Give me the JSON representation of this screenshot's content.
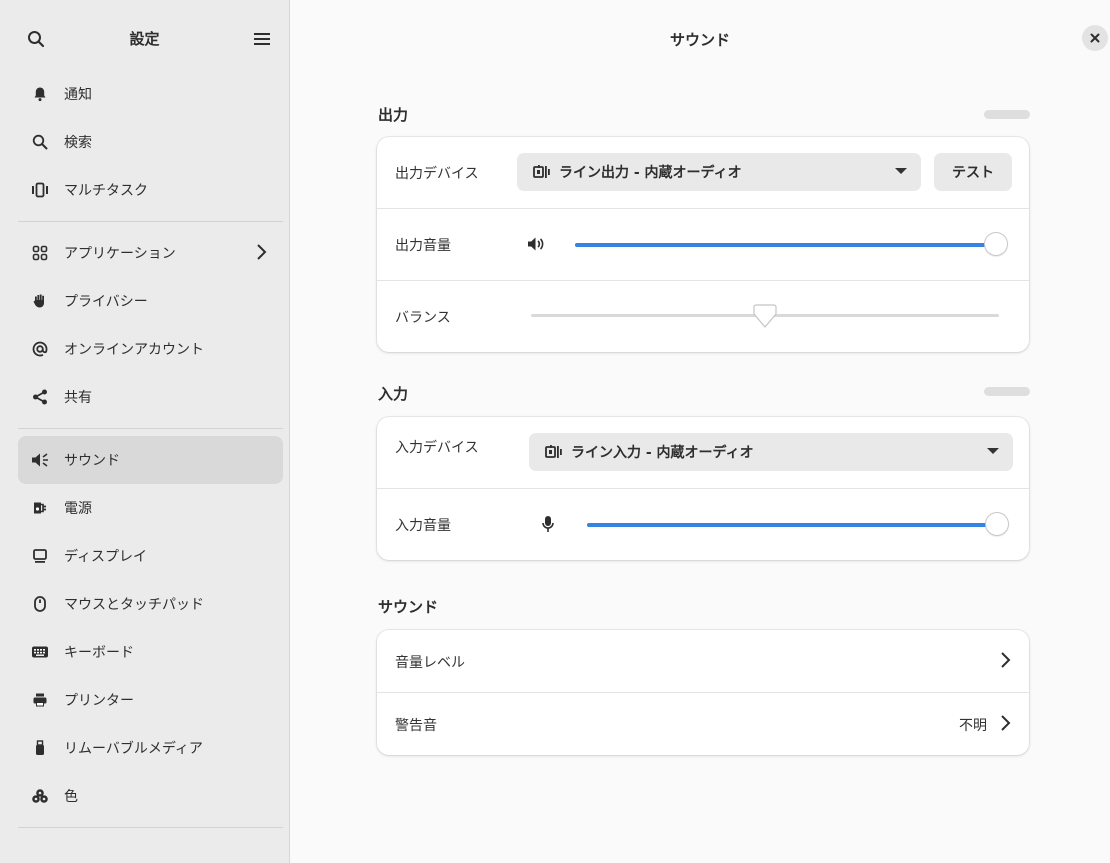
{
  "sidebar": {
    "title": "設定",
    "items": [
      {
        "label": "通知",
        "icon": "bell-icon"
      },
      {
        "label": "検索",
        "icon": "search-icon"
      },
      {
        "label": "マルチタスク",
        "icon": "multitask-icon"
      },
      {
        "label": "アプリケーション",
        "icon": "apps-grid-icon"
      },
      {
        "label": "プライバシー",
        "icon": "hand-icon"
      },
      {
        "label": "オンラインアカウント",
        "icon": "at-sign-icon"
      },
      {
        "label": "共有",
        "icon": "share-icon"
      },
      {
        "label": "サウンド",
        "icon": "speaker-icon"
      },
      {
        "label": "電源",
        "icon": "power-icon"
      },
      {
        "label": "ディスプレイ",
        "icon": "display-icon"
      },
      {
        "label": "マウスとタッチパッド",
        "icon": "mouse-icon"
      },
      {
        "label": "キーボード",
        "icon": "keyboard-icon"
      },
      {
        "label": "プリンター",
        "icon": "printer-icon"
      },
      {
        "label": "リムーバブルメディア",
        "icon": "usb-icon"
      },
      {
        "label": "色",
        "icon": "color-icon"
      }
    ]
  },
  "main": {
    "title": "サウンド",
    "output": {
      "section": "出力",
      "device_label": "出力デバイス",
      "device_value": "ライン出力 - 内蔵オーディオ",
      "test_label": "テスト",
      "volume_label": "出力音量",
      "volume_level": 1.0,
      "balance_label": "バランス",
      "balance_level": 0.5
    },
    "input": {
      "section": "入力",
      "device_label": "入力デバイス",
      "device_value": "ライン入力 - 内蔵オーディオ",
      "volume_label": "入力音量",
      "volume_level": 1.0
    },
    "sounds": {
      "section": "サウンド",
      "levels_label": "音量レベル",
      "alert_label": "警告音",
      "alert_value": "不明"
    }
  },
  "colors": {
    "accent": "#3584e4"
  }
}
